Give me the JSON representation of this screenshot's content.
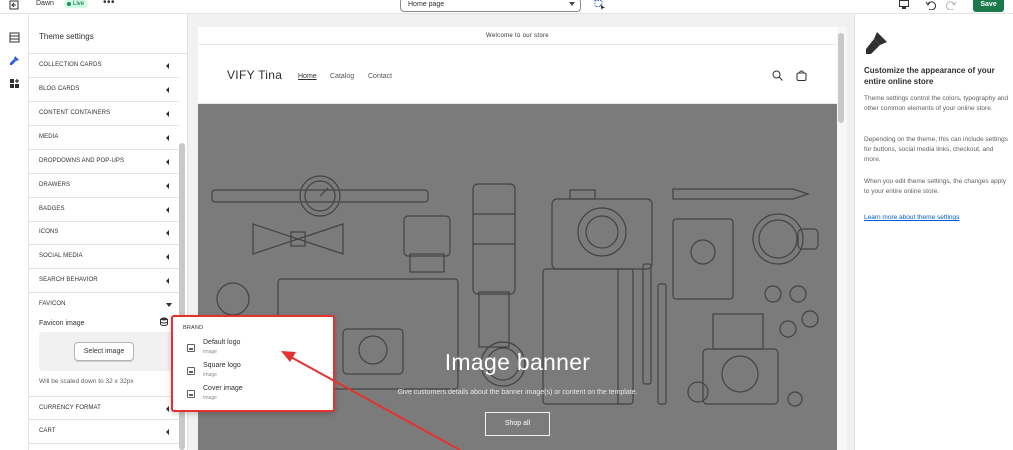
{
  "topbar": {
    "store_name": "Dawn",
    "live_badge": "Live",
    "more_label": "•••",
    "page_select": "Home page",
    "save_label": "Save"
  },
  "settings": {
    "title": "Theme settings",
    "sections": [
      {
        "label": "COLLECTION CARDS"
      },
      {
        "label": "BLOG CARDS"
      },
      {
        "label": "CONTENT CONTAINERS"
      },
      {
        "label": "MEDIA"
      },
      {
        "label": "DROPDOWNS AND POP-UPS"
      },
      {
        "label": "DRAWERS"
      },
      {
        "label": "BADGES"
      },
      {
        "label": "ICONS"
      },
      {
        "label": "SOCIAL MEDIA"
      },
      {
        "label": "SEARCH BEHAVIOR"
      },
      {
        "label": "FAVICON"
      }
    ],
    "favicon": {
      "label": "Favicon image",
      "select_button": "Select image",
      "note": "Will be scaled down to 32 x 32px"
    },
    "sections_after": [
      {
        "label": "CURRENCY FORMAT"
      },
      {
        "label": "CART"
      }
    ]
  },
  "preview": {
    "announcement": "Welcome to our store",
    "logo": "VIFY Tina",
    "nav": [
      "Home",
      "Catalog",
      "Contact"
    ],
    "banner": {
      "title": "Image banner",
      "subtitle": "Give customers details about the banner image(s) or content on the template.",
      "button": "Shop all"
    }
  },
  "popover": {
    "heading": "BRAND",
    "options": [
      {
        "name": "Default logo",
        "type": "Image"
      },
      {
        "name": "Square logo",
        "type": "Image"
      },
      {
        "name": "Cover image",
        "type": "Image"
      }
    ]
  },
  "help": {
    "heading": "Customize the appearance of your entire online store",
    "p1": "Theme settings control the colors, typography and other common elements of your online store.",
    "p2": "Depending on the theme, this can include settings for buttons, social media links, checkout, and more.",
    "p3": "When you edit theme settings, the changes apply to your entire online store.",
    "link": "Learn more about theme settings"
  },
  "colors": {
    "save": "#1a7a4c",
    "annotation": "#e3322f",
    "link": "#005bd3"
  }
}
